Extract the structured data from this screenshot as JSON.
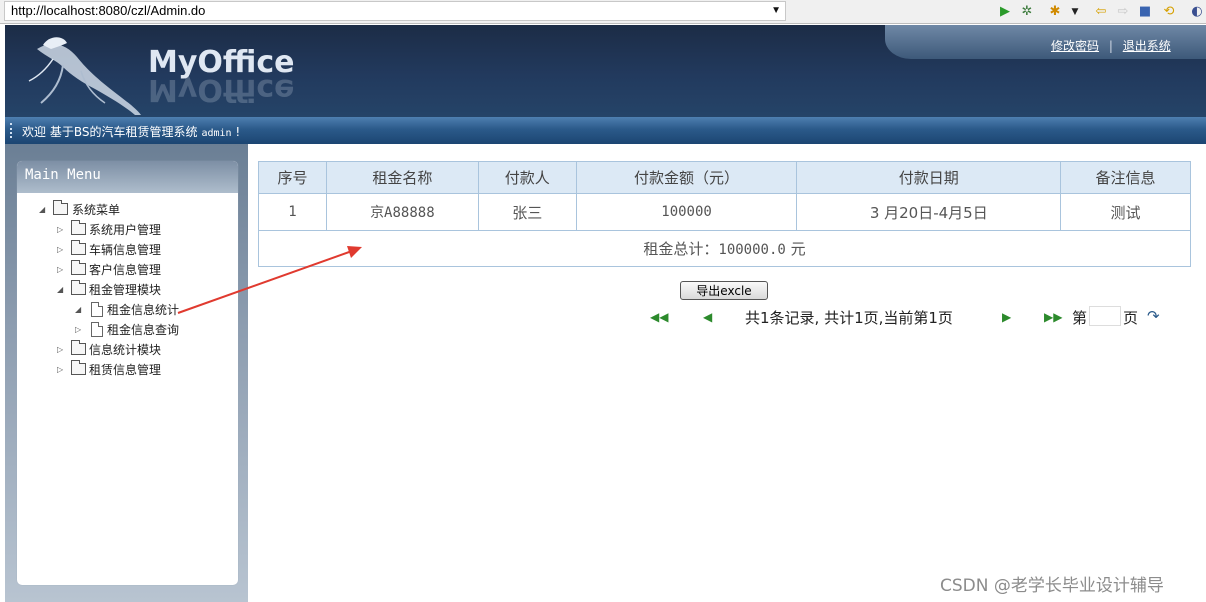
{
  "browser": {
    "url": "http://localhost:8080/czl/Admin.do",
    "toolbar_icons": [
      "run-icon",
      "debug-icon",
      "favorite-icon",
      "dropdown-icon",
      "back-icon",
      "forward-icon",
      "stop-icon",
      "sync-icon",
      "eclipse-icon"
    ]
  },
  "header": {
    "logo_text": "MyOffice",
    "links": {
      "change_password": "修改密码",
      "separator": "|",
      "logout": "退出系统"
    }
  },
  "welcome": {
    "text": "欢迎 基于BS的汽车租赁管理系统",
    "user": "admin",
    "suffix": "!"
  },
  "sidebar": {
    "title": "Main Menu",
    "root": "系统菜单",
    "items": [
      {
        "label": "系统用户管理"
      },
      {
        "label": "车辆信息管理"
      },
      {
        "label": "客户信息管理"
      },
      {
        "label": "租金管理模块"
      },
      {
        "label": "租金信息统计"
      },
      {
        "label": "租金信息查询"
      },
      {
        "label": "信息统计模块"
      },
      {
        "label": "租赁信息管理"
      }
    ]
  },
  "table": {
    "headers": [
      "序号",
      "租金名称",
      "付款人",
      "付款金额（元）",
      "付款日期",
      "备注信息"
    ],
    "rows": [
      {
        "no": "1",
        "name": "京A88888",
        "payer": "张三",
        "amount": "100000",
        "date": "3 月20日-4月5日",
        "note": "测试"
      }
    ],
    "total_label": "租金总计：",
    "total_value": "100000.0",
    "total_unit": "元"
  },
  "actions": {
    "export_label": "导出excle"
  },
  "pager": {
    "summary": "共1条记录, 共计1页,当前第1页",
    "page_prefix": "第",
    "page_suffix": "页",
    "page_value": ""
  },
  "watermark": "CSDN @老学长毕业设计辅导",
  "colors": {
    "banner": "#223a5e",
    "welcome_bar": "#2b5a8a",
    "table_header": "#dce9f5",
    "arrow": "#e03a2f"
  }
}
